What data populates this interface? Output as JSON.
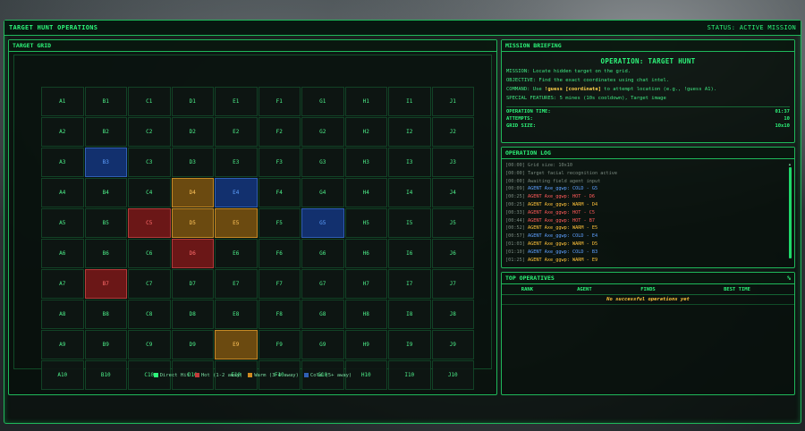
{
  "window": {
    "title": "TARGET HUNT OPERATIONS",
    "status": "STATUS: ACTIVE MISSION"
  },
  "grid_panel": {
    "title": "TARGET GRID",
    "columns": [
      "A",
      "B",
      "C",
      "D",
      "E",
      "F",
      "G",
      "H",
      "I",
      "J"
    ],
    "rows": 10,
    "cells": [
      [
        "A1",
        "B1",
        "C1",
        "D1",
        "E1",
        "F1",
        "G1",
        "H1",
        "I1",
        "J1"
      ],
      [
        "A2",
        "B2",
        "C2",
        "D2",
        "E2",
        "F2",
        "G2",
        "H2",
        "I2",
        "J2"
      ],
      [
        "A3",
        "B3",
        "C3",
        "D3",
        "E3",
        "F3",
        "G3",
        "H3",
        "I3",
        "J3"
      ],
      [
        "A4",
        "B4",
        "C4",
        "D4",
        "E4",
        "F4",
        "G4",
        "H4",
        "I4",
        "J4"
      ],
      [
        "A5",
        "B5",
        "C5",
        "D5",
        "E5",
        "F5",
        "G5",
        "H5",
        "I5",
        "J5"
      ],
      [
        "A6",
        "B6",
        "C6",
        "D6",
        "E6",
        "F6",
        "G6",
        "H6",
        "I6",
        "J6"
      ],
      [
        "A7",
        "B7",
        "C7",
        "D7",
        "E7",
        "F7",
        "G7",
        "H7",
        "I7",
        "J7"
      ],
      [
        "A8",
        "B8",
        "C8",
        "D8",
        "E8",
        "F8",
        "G8",
        "H8",
        "I8",
        "J8"
      ],
      [
        "A9",
        "B9",
        "C9",
        "D9",
        "E9",
        "F9",
        "G9",
        "H9",
        "I9",
        "J9"
      ],
      [
        "A10",
        "B10",
        "C10",
        "D10",
        "E10",
        "F10",
        "G10",
        "H10",
        "I10",
        "J10"
      ]
    ],
    "marked": {
      "B3": "cold",
      "D4": "warm",
      "E4": "cold",
      "C5": "hot",
      "D5": "warm",
      "E5": "warm",
      "G5": "cold",
      "D6": "hot",
      "B7": "hot",
      "E9": "warm"
    },
    "legend": [
      {
        "label": "Direct Hit",
        "color": "#2df57a"
      },
      {
        "label": "Hot (1-2 away)",
        "color": "#c23a3a"
      },
      {
        "label": "Warm (3-4 away)",
        "color": "#d08a20"
      },
      {
        "label": "Cold (5+ away)",
        "color": "#2f5fb5"
      }
    ]
  },
  "briefing": {
    "header": "MISSION BRIEFING",
    "title": "OPERATION: TARGET HUNT",
    "mission": "MISSION: Locate hidden target on the grid.",
    "objective": "OBJECTIVE: Find the exact coordinates using chat intel.",
    "command_pre": "COMMAND: Use ",
    "command_hl": "!guess [coordinate]",
    "command_post": " to attempt location (e.g., !guess A1).",
    "special": "SPECIAL FEATURES: 5 mines (10s cooldown), Target image",
    "stats": [
      {
        "label": "OPERATION TIME:",
        "value": "01:37"
      },
      {
        "label": "ATTEMPTS:",
        "value": "10"
      },
      {
        "label": "GRID SIZE:",
        "value": "10x10"
      }
    ]
  },
  "log": {
    "header": "OPERATION LOG",
    "entries": [
      {
        "ts": "[00:00]",
        "type": "sys",
        "text": "Grid size: 10x10"
      },
      {
        "ts": "[00:00]",
        "type": "sys",
        "text": "Target facial recognition active"
      },
      {
        "ts": "[00:00]",
        "type": "sys",
        "text": "Awaiting field agent input"
      },
      {
        "ts": "[00:09]",
        "type": "cold",
        "agent": "AGENT Axe_ggwp:",
        "result": "COLD - G5"
      },
      {
        "ts": "[00:25]",
        "type": "hot",
        "agent": "AGENT Axe_ggwp:",
        "result": "HOT - D6"
      },
      {
        "ts": "[00:25]",
        "type": "warm",
        "agent": "AGENT Axe_ggwp:",
        "result": "WARM - D4"
      },
      {
        "ts": "[00:33]",
        "type": "hot",
        "agent": "AGENT Axe_ggwp:",
        "result": "HOT - C5"
      },
      {
        "ts": "[00:44]",
        "type": "hot",
        "agent": "AGENT Axe_ggwp:",
        "result": "HOT - B7"
      },
      {
        "ts": "[00:52]",
        "type": "warm",
        "agent": "AGENT Axe_ggwp:",
        "result": "WARM - E5"
      },
      {
        "ts": "[00:57]",
        "type": "cold",
        "agent": "AGENT Axe_ggwp:",
        "result": "COLD - E4"
      },
      {
        "ts": "[01:03]",
        "type": "warm",
        "agent": "AGENT Axe_ggwp:",
        "result": "WARM - D5"
      },
      {
        "ts": "[01:10]",
        "type": "cold",
        "agent": "AGENT Axe_ggwp:",
        "result": "COLD - B3"
      },
      {
        "ts": "[01:25]",
        "type": "warm",
        "agent": "AGENT Axe_ggwp:",
        "result": "WARM - E9"
      }
    ]
  },
  "operatives": {
    "header": "TOP OPERATIVES",
    "header_badge": "%",
    "columns": [
      "RANK",
      "AGENT",
      "FINDS",
      "BEST TIME"
    ],
    "empty_message": "No successful operations yet"
  }
}
